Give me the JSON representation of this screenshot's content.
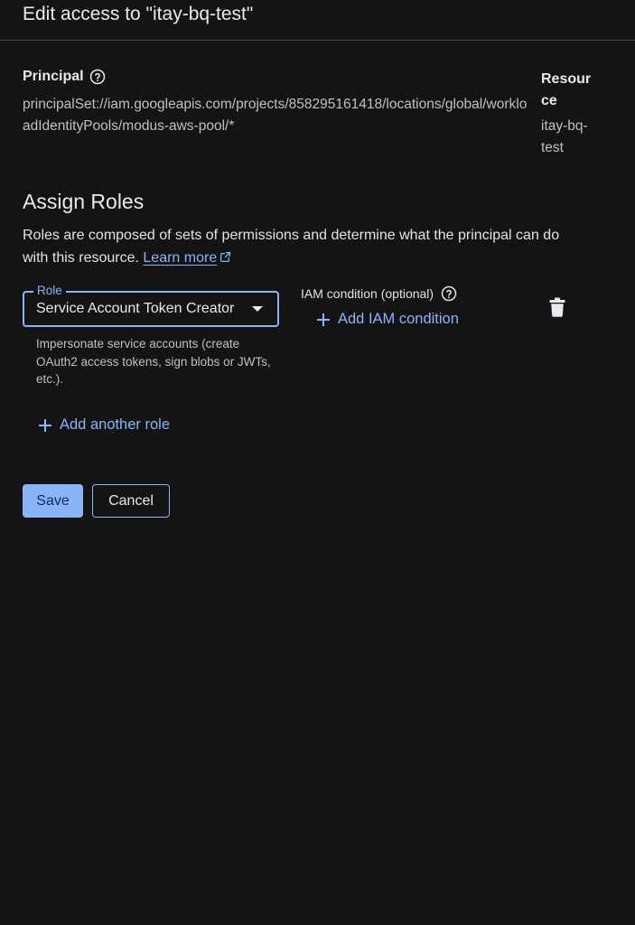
{
  "dialog": {
    "title": "Edit access to \"itay-bq-test\""
  },
  "principal": {
    "label": "Principal",
    "value": "principalSet://iam.googleapis.com/projects/858295161418/locations/global/workloadIdentityPools/modus-aws-pool/*"
  },
  "resource": {
    "label": "Resource",
    "value": "itay-bq-test"
  },
  "assign_roles": {
    "title": "Assign Roles",
    "description": "Roles are composed of sets of permissions and determine what the principal can do with this resource.",
    "learn_more_label": "Learn more"
  },
  "role": {
    "field_label": "Role",
    "selected_value": "Service Account Token Creator",
    "hint": "Impersonate service accounts (create OAuth2 access tokens, sign blobs or JWTs, etc.)."
  },
  "iam_condition": {
    "label": "IAM condition (optional)",
    "add_label": "Add IAM condition"
  },
  "add_another_role_label": "Add another role",
  "actions": {
    "save_label": "Save",
    "cancel_label": "Cancel"
  },
  "colors": {
    "background": "#141414",
    "accent": "#8ab4f8",
    "divider": "#4a4b4e",
    "text_primary": "#e8eaed",
    "text_secondary": "#bdc1c6"
  }
}
